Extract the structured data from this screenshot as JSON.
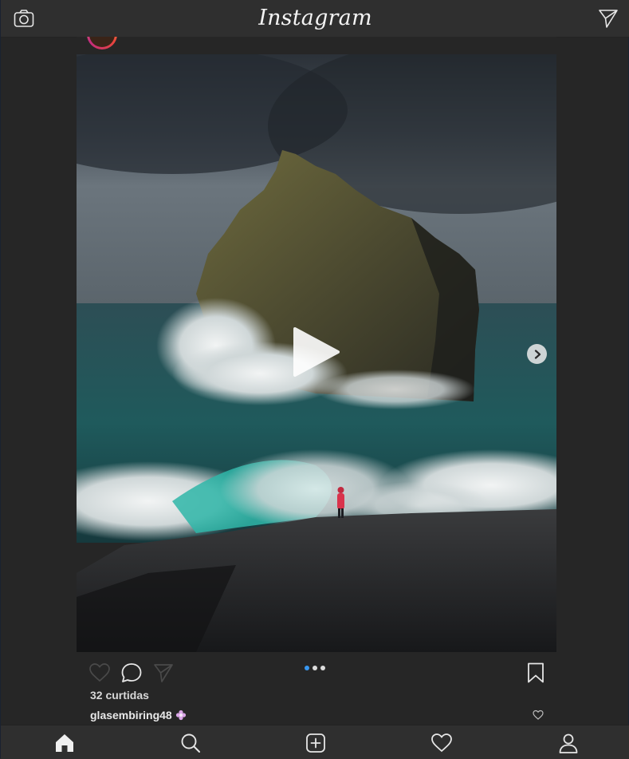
{
  "app": {
    "title": "Instagram"
  },
  "post": {
    "likes_text": "32 curtidas",
    "username": "glasembiring48",
    "carousel": {
      "current": 1,
      "total": 3
    }
  },
  "colors": {
    "background": "#262626",
    "bar": "#2f2f2f",
    "active_dot": "#3897f0",
    "icon": "#e6e6e6"
  },
  "icons": {
    "top_left": "camera-icon",
    "top_right": "direct-send-icon",
    "actions": [
      "heart-icon",
      "comment-icon",
      "share-icon",
      "bookmark-icon"
    ],
    "nav": [
      "home-icon",
      "search-icon",
      "add-post-icon",
      "activity-heart-icon",
      "profile-icon"
    ]
  }
}
